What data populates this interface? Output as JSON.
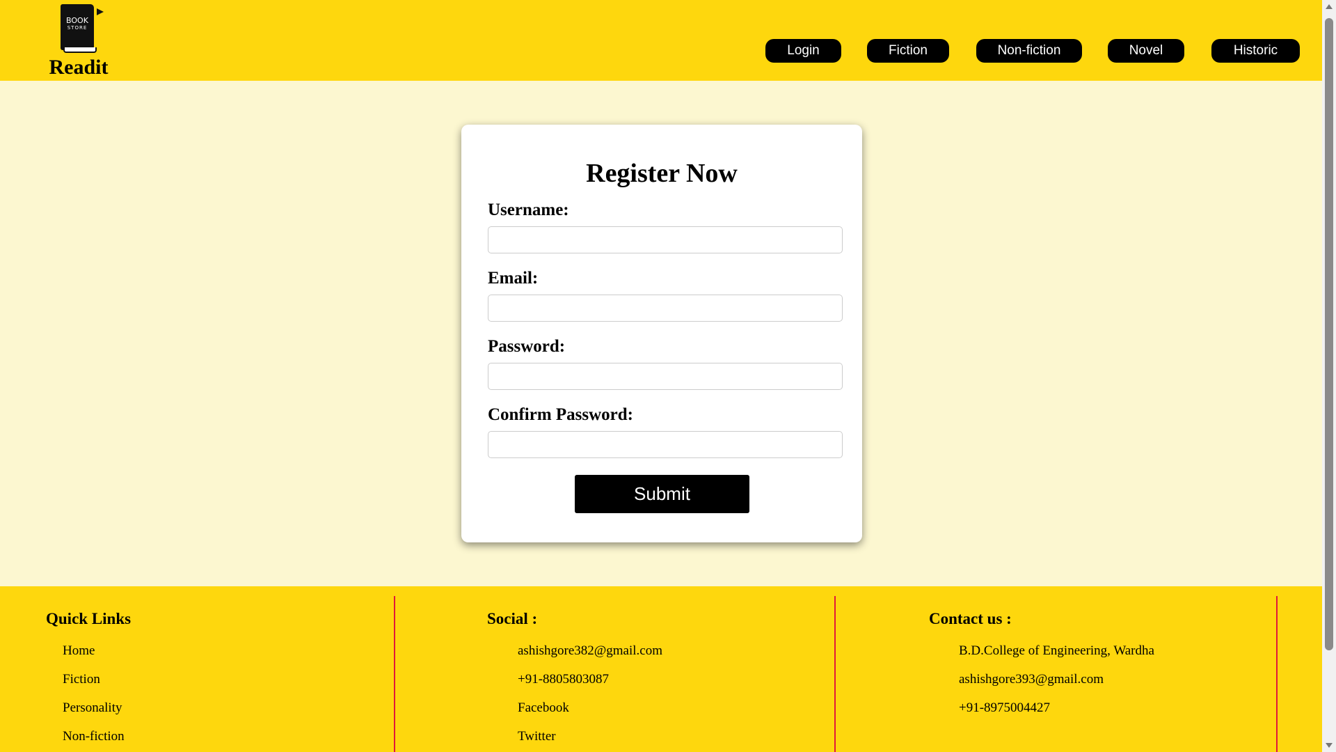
{
  "header": {
    "book_icon_text": "BOOK",
    "book_icon_subtext": "STORE",
    "brand": "Readit",
    "nav": [
      "Login",
      "Fiction",
      "Non-fiction",
      "Novel",
      "Historic"
    ]
  },
  "form": {
    "title": "Register Now",
    "fields": [
      {
        "label": "Username:",
        "value": ""
      },
      {
        "label": "Email:",
        "value": ""
      },
      {
        "label": "Password:",
        "value": ""
      },
      {
        "label": "Confirm Password:",
        "value": ""
      }
    ],
    "submit_label": "Submit"
  },
  "footer": {
    "columns": [
      {
        "title": "Quick Links",
        "items": [
          "Home",
          "Fiction",
          "Personality",
          "Non-fiction"
        ]
      },
      {
        "title": "Social :",
        "items": [
          "ashishgore382@gmail.com",
          "+91-8805803087",
          "Facebook",
          "Twitter"
        ]
      },
      {
        "title": "Contact us :",
        "items": [
          "B.D.College of Engineering, Wardha",
          "ashishgore393@gmail.com",
          "+91-8975004427"
        ]
      }
    ]
  },
  "colors": {
    "header_bg": "#fed70d",
    "page_bg": "#fcf7d0",
    "divider": "#e0183a",
    "button": "#000000"
  }
}
